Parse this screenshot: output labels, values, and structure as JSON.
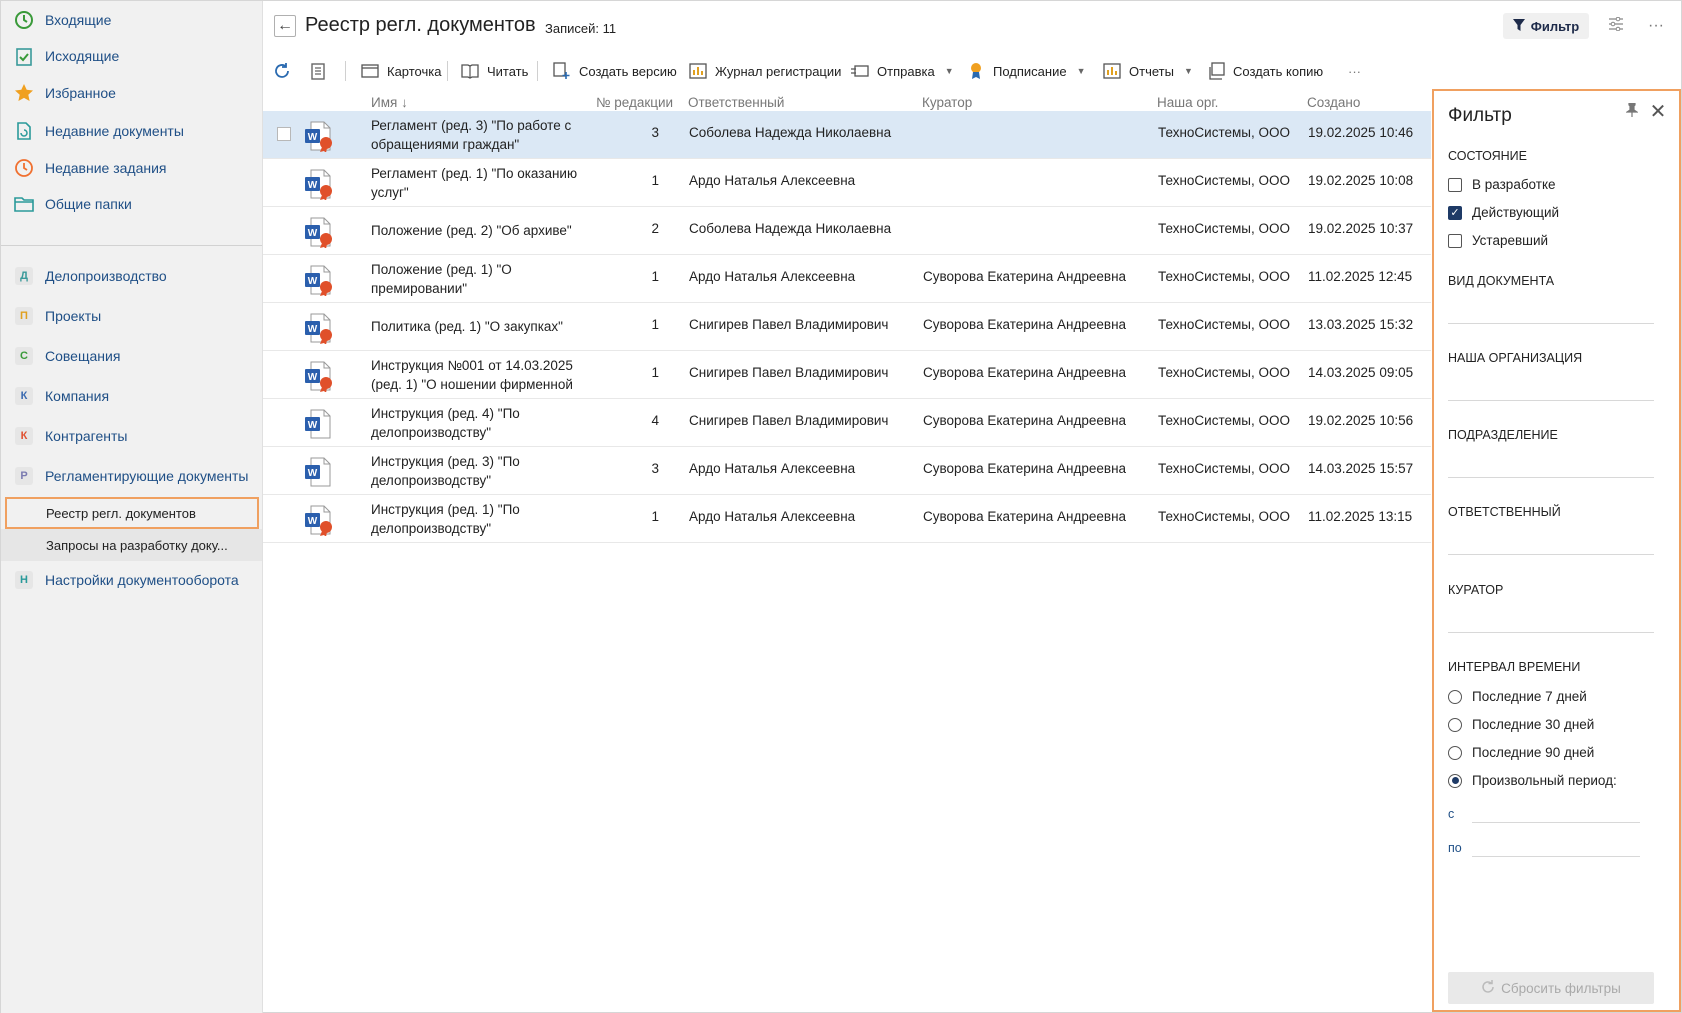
{
  "sidebar": {
    "top_items": [
      {
        "label": "Входящие",
        "icon": "inbox-icon",
        "color": "#3a9a3a"
      },
      {
        "label": "Исходящие",
        "icon": "outbox-icon",
        "color": "#3a9a3a"
      },
      {
        "label": "Избранное",
        "icon": "star-icon",
        "color": "#f0a020"
      },
      {
        "label": "Недавние документы",
        "icon": "recent-documents-icon",
        "color": "#2a9a9a"
      },
      {
        "label": "Недавние задания",
        "icon": "recent-tasks-icon",
        "color": "#f07030"
      },
      {
        "label": "Общие папки",
        "icon": "folder-icon",
        "color": "#2a9a9a"
      }
    ],
    "modules": [
      {
        "letter": "Д",
        "label": "Делопроизводство",
        "color": "#3a9a9a"
      },
      {
        "letter": "П",
        "label": "Проекты",
        "color": "#e0a020"
      },
      {
        "letter": "С",
        "label": "Совещания",
        "color": "#3a9a3a"
      },
      {
        "letter": "К",
        "label": "Компания",
        "color": "#3a6ab0"
      },
      {
        "letter": "К",
        "label": "Контрагенты",
        "color": "#e05030"
      },
      {
        "letter": "Р",
        "label": "Регламентирующие документы",
        "color": "#7a7ab0"
      }
    ],
    "sub_items": [
      "Реестр регл. документов",
      "Запросы на разработку доку..."
    ],
    "last_module": {
      "letter": "Н",
      "label": "Настройки документооборота",
      "color": "#2a9a9a"
    }
  },
  "header": {
    "title": "Реестр регл. документов",
    "count": "Записей: 11",
    "filter_label": "Фильтр"
  },
  "toolbar": {
    "card": "Карточка",
    "read": "Читать",
    "create_version": "Создать версию",
    "journal": "Журнал регистрации",
    "send": "Отправка",
    "signing": "Подписание",
    "reports": "Отчеты",
    "copy": "Создать копию"
  },
  "table": {
    "columns": [
      "Имя",
      "№ редакции",
      "Ответственный",
      "Куратор",
      "Наша орг.",
      "Создано"
    ],
    "sort_indicator": "↓",
    "rows": [
      {
        "name": "Регламент (ред. 3) \"По работе с обращениями граждан\"",
        "rev": "3",
        "responsible": "Соболева Надежда Николаевна",
        "curator": "",
        "org": "ТехноСистемы, ООО",
        "created": "19.02.2025 10:46",
        "signed": true
      },
      {
        "name": "Регламент (ред. 1) \"По оказанию услуг\"",
        "rev": "1",
        "responsible": "Ардо Наталья Алексеевна",
        "curator": "",
        "org": "ТехноСистемы, ООО",
        "created": "19.02.2025 10:08",
        "signed": true
      },
      {
        "name": "Положение (ред. 2) \"Об архиве\"",
        "rev": "2",
        "responsible": "Соболева Надежда Николаевна",
        "curator": "",
        "org": "ТехноСистемы, ООО",
        "created": "19.02.2025 10:37",
        "signed": true
      },
      {
        "name": "Положение (ред. 1) \"О премировании\"",
        "rev": "1",
        "responsible": "Ардо Наталья Алексеевна",
        "curator": "Суворова Екатерина Андреевна",
        "org": "ТехноСистемы, ООО",
        "created": "11.02.2025 12:45",
        "signed": true
      },
      {
        "name": "Политика (ред. 1) \"О закупках\"",
        "rev": "1",
        "responsible": "Снигирев Павел Владимирович",
        "curator": "Суворова Екатерина Андреевна",
        "org": "ТехноСистемы, ООО",
        "created": "13.03.2025 15:32",
        "signed": true
      },
      {
        "name": "Инструкция №001 от 14.03.2025 (ред. 1) \"О ношении фирменной",
        "rev": "1",
        "responsible": "Снигирев Павел Владимирович",
        "curator": "Суворова Екатерина Андреевна",
        "org": "ТехноСистемы, ООО",
        "created": "14.03.2025 09:05",
        "signed": true
      },
      {
        "name": "Инструкция (ред. 4) \"По делопроизводству\"",
        "rev": "4",
        "responsible": "Снигирев Павел Владимирович",
        "curator": "Суворова Екатерина Андреевна",
        "org": "ТехноСистемы, ООО",
        "created": "19.02.2025 10:56",
        "signed": false
      },
      {
        "name": "Инструкция (ред. 3) \"По делопроизводству\"",
        "rev": "3",
        "responsible": "Ардо Наталья Алексеевна",
        "curator": "Суворова Екатерина Андреевна",
        "org": "ТехноСистемы, ООО",
        "created": "14.03.2025 15:57",
        "signed": false
      },
      {
        "name": "Инструкция (ред. 1) \"По делопроизводству\"",
        "rev": "1",
        "responsible": "Ардо Наталья Алексеевна",
        "curator": "Суворова Екатерина Андреевна",
        "org": "ТехноСистемы, ООО",
        "created": "11.02.2025 13:15",
        "signed": true
      }
    ]
  },
  "filter": {
    "title": "Фильтр",
    "state_label": "СОСТОЯНИЕ",
    "states": [
      {
        "label": "В разработке",
        "checked": false
      },
      {
        "label": "Действующий",
        "checked": true
      },
      {
        "label": "Устаревший",
        "checked": false
      }
    ],
    "doc_type_label": "ВИД ДОКУМЕНТА",
    "org_label": "НАША ОРГАНИЗАЦИЯ",
    "dept_label": "ПОДРАЗДЕЛЕНИЕ",
    "responsible_label": "ОТВЕТСТВЕННЫЙ",
    "curator_label": "КУРАТОР",
    "interval_label": "ИНТЕРВАЛ ВРЕМЕНИ",
    "intervals": [
      {
        "label": "Последние 7 дней",
        "selected": false
      },
      {
        "label": "Последние 30 дней",
        "selected": false
      },
      {
        "label": "Последние 90 дней",
        "selected": false
      },
      {
        "label": "Произвольный период:",
        "selected": true
      }
    ],
    "from_label": "с",
    "to_label": "по",
    "reset_label": "Сбросить фильтры"
  }
}
